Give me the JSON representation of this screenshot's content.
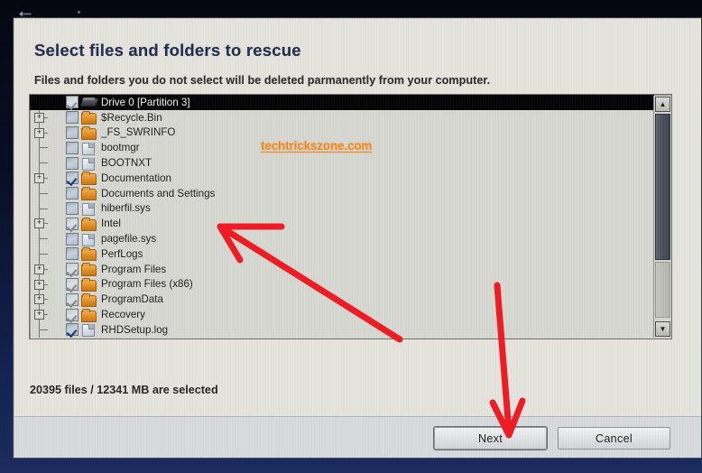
{
  "window": {
    "title": "Select files and folders to rescue",
    "subtitle": "Files and folders you do not select will be deleted parmanently from your computer.",
    "status": "20395 files / 12341 MB are selected",
    "watermark": "techtrickszone.com",
    "back_icon": "←"
  },
  "colors": {
    "dialog_bg": "#e5e4dd",
    "title_text": "#1c2a4a",
    "watermark": "#f08a1e",
    "annotation_arrow": "#ee1c24",
    "desktop": "#11204a",
    "selected_row_bg": "#000000",
    "folder_icon": "#e08c1e",
    "checkbox_check": "#16306d"
  },
  "tree": {
    "rows": [
      {
        "label": "Drive 0 [Partition 3]",
        "icon": "drive-icon",
        "check": "checked-gray",
        "expander": "none",
        "depth": 0,
        "selected": true
      },
      {
        "label": "$Recycle.Bin",
        "icon": "folder-icon",
        "check": "unchecked",
        "expander": "plus",
        "depth": 1,
        "selected": false
      },
      {
        "label": "_FS_SWRINFO",
        "icon": "folder-icon",
        "check": "unchecked",
        "expander": "plus",
        "depth": 1,
        "selected": false
      },
      {
        "label": "bootmgr",
        "icon": "file-icon",
        "check": "unchecked",
        "expander": "none",
        "depth": 1,
        "selected": false
      },
      {
        "label": "BOOTNXT",
        "icon": "file-icon",
        "check": "unchecked",
        "expander": "none",
        "depth": 1,
        "selected": false
      },
      {
        "label": "Documentation",
        "icon": "folder-icon",
        "check": "checked-dark",
        "expander": "plus",
        "depth": 1,
        "selected": false
      },
      {
        "label": "Documents and Settings",
        "icon": "folder-icon",
        "check": "unchecked",
        "expander": "none",
        "depth": 1,
        "selected": false
      },
      {
        "label": "hiberfil.sys",
        "icon": "file-icon",
        "check": "unchecked",
        "expander": "none",
        "depth": 1,
        "selected": false
      },
      {
        "label": "Intel",
        "icon": "folder-icon",
        "check": "checked-gray",
        "expander": "plus",
        "depth": 1,
        "selected": false
      },
      {
        "label": "pagefile.sys",
        "icon": "file-icon",
        "check": "unchecked",
        "expander": "none",
        "depth": 1,
        "selected": false
      },
      {
        "label": "PerfLogs",
        "icon": "folder-icon",
        "check": "unchecked",
        "expander": "none",
        "depth": 1,
        "selected": false
      },
      {
        "label": "Program Files",
        "icon": "folder-icon",
        "check": "checked-gray",
        "expander": "plus",
        "depth": 1,
        "selected": false
      },
      {
        "label": "Program Files (x86)",
        "icon": "folder-icon",
        "check": "checked-gray",
        "expander": "plus",
        "depth": 1,
        "selected": false
      },
      {
        "label": "ProgramData",
        "icon": "folder-icon",
        "check": "checked-gray",
        "expander": "plus",
        "depth": 1,
        "selected": false
      },
      {
        "label": "Recovery",
        "icon": "folder-icon",
        "check": "checked-gray",
        "expander": "plus",
        "depth": 1,
        "selected": false
      },
      {
        "label": "RHDSetup.log",
        "icon": "file-icon",
        "check": "checked-dark",
        "expander": "none",
        "depth": 1,
        "selected": false
      }
    ],
    "expander_glyph": "+"
  },
  "scrollbar": {
    "up_glyph": "▲",
    "down_glyph": "▼"
  },
  "buttons": {
    "next": "Next",
    "cancel": "Cancel"
  },
  "annotations": [
    {
      "name": "arrow-to-tree-list",
      "color": "#ee1c24"
    },
    {
      "name": "arrow-to-next-button",
      "color": "#ee1c24"
    }
  ]
}
